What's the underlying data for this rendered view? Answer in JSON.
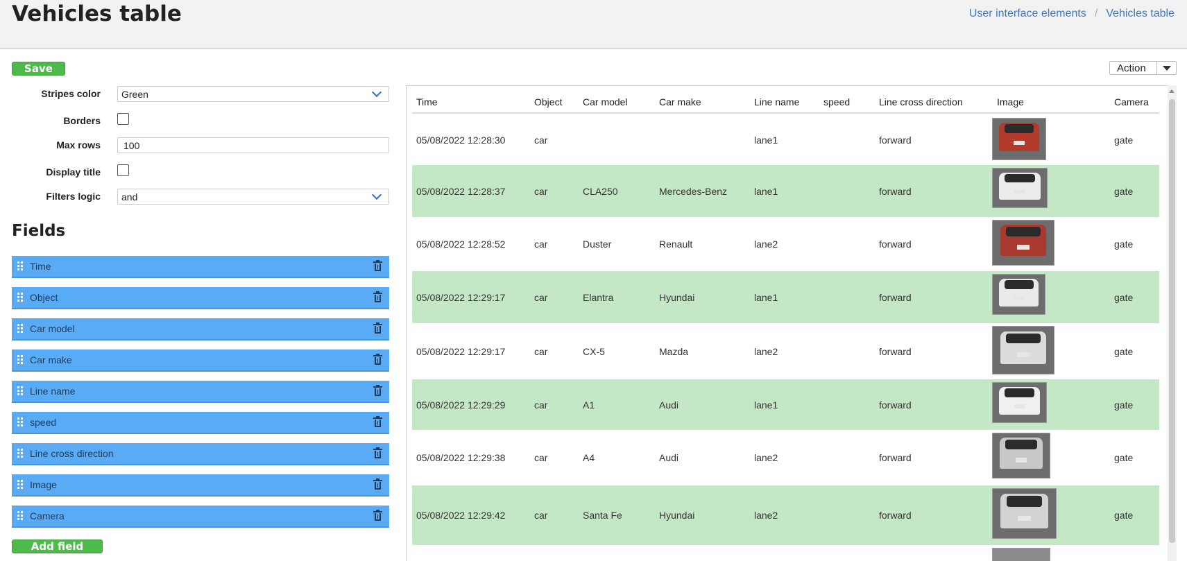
{
  "header": {
    "title": "Vehicles table",
    "breadcrumb": [
      "User interface elements",
      "Vehicles table"
    ],
    "breadcrumb_sep": "/"
  },
  "toolbar": {
    "save_label": "Save",
    "action_label": "Action"
  },
  "settings": {
    "stripes_color": {
      "label": "Stripes color",
      "value": "Green"
    },
    "borders": {
      "label": "Borders",
      "checked": false
    },
    "max_rows": {
      "label": "Max rows",
      "value": "100"
    },
    "display_title": {
      "label": "Display title",
      "checked": false
    },
    "filters_logic": {
      "label": "Filters logic",
      "value": "and"
    }
  },
  "fields": {
    "title": "Fields",
    "items": [
      "Time",
      "Object",
      "Car model",
      "Car make",
      "Line name",
      "speed",
      "Line cross direction",
      "Image",
      "Camera"
    ],
    "add_label": "Add field"
  },
  "table": {
    "columns": [
      "Time",
      "Object",
      "Car model",
      "Car make",
      "Line name",
      "speed",
      "Line cross direction",
      "Image",
      "Camera"
    ],
    "rows": [
      {
        "time": "05/08/2022 12:28:30",
        "object": "car",
        "model": "",
        "make": "",
        "line": "lane1",
        "speed": "",
        "direction": "forward",
        "camera": "gate",
        "image": "red car rear"
      },
      {
        "time": "05/08/2022 12:28:37",
        "object": "car",
        "model": "CLA250",
        "make": "Mercedes-Benz",
        "line": "lane1",
        "speed": "",
        "direction": "forward",
        "camera": "gate",
        "image": "white car rear"
      },
      {
        "time": "05/08/2022 12:28:52",
        "object": "car",
        "model": "Duster",
        "make": "Renault",
        "line": "lane2",
        "speed": "",
        "direction": "forward",
        "camera": "gate",
        "image": "red car rear"
      },
      {
        "time": "05/08/2022 12:29:17",
        "object": "car",
        "model": "Elantra",
        "make": "Hyundai",
        "line": "lane1",
        "speed": "",
        "direction": "forward",
        "camera": "gate",
        "image": "white car rear"
      },
      {
        "time": "05/08/2022 12:29:17",
        "object": "car",
        "model": "CX-5",
        "make": "Mazda",
        "line": "lane2",
        "speed": "",
        "direction": "forward",
        "camera": "gate",
        "image": "white suv rear"
      },
      {
        "time": "05/08/2022 12:29:29",
        "object": "car",
        "model": "A1",
        "make": "Audi",
        "line": "lane1",
        "speed": "",
        "direction": "forward",
        "camera": "gate",
        "image": "white car rear"
      },
      {
        "time": "05/08/2022 12:29:38",
        "object": "car",
        "model": "A4",
        "make": "Audi",
        "line": "lane2",
        "speed": "",
        "direction": "forward",
        "camera": "gate",
        "image": "silver car rear"
      },
      {
        "time": "05/08/2022 12:29:42",
        "object": "car",
        "model": "Santa Fe",
        "make": "Hyundai",
        "line": "lane2",
        "speed": "",
        "direction": "forward",
        "camera": "gate",
        "image": "silver suv rear"
      }
    ],
    "stripe_color": "#c4e8c6"
  },
  "colors": {
    "accent_green": "#4cbb4a",
    "field_blue": "#5aabf5",
    "link_blue": "#3a78c9"
  }
}
